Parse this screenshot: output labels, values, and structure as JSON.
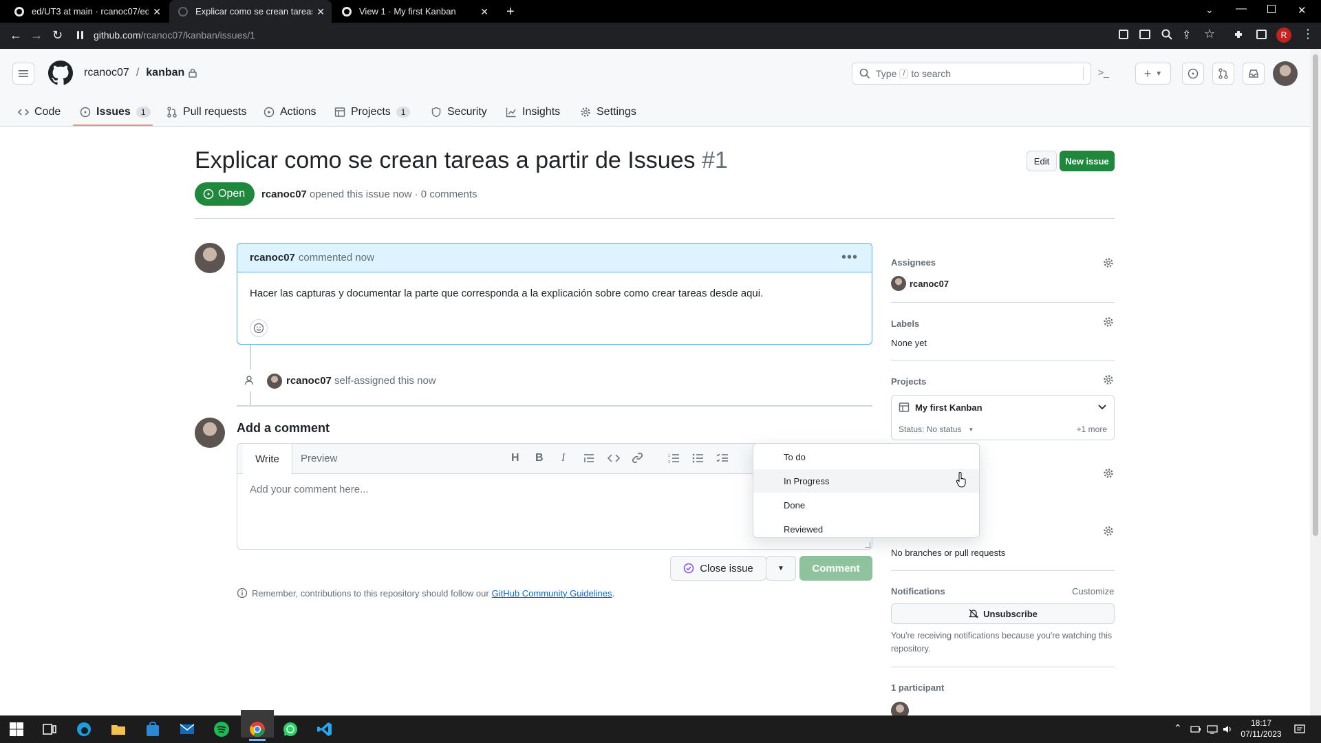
{
  "browser": {
    "tabs": [
      {
        "title": "ed/UT3 at main · rcanoc07/ed"
      },
      {
        "title": "Explicar como se crean tareas a ..."
      },
      {
        "title": "View 1 · My first Kanban"
      }
    ],
    "url_host": "github.com",
    "url_path": "/rcanoc07/kanban/issues/1",
    "profile_initial": "R"
  },
  "header": {
    "owner": "rcanoc07",
    "separator": "/",
    "repo": "kanban",
    "search_type": "Type",
    "search_key": "/",
    "search_rest": "to search"
  },
  "repo_nav": [
    {
      "label": "Code",
      "icon": "code-icon"
    },
    {
      "label": "Issues",
      "count": "1",
      "icon": "issue-icon"
    },
    {
      "label": "Pull requests",
      "icon": "pull-request-icon"
    },
    {
      "label": "Actions",
      "icon": "play-icon"
    },
    {
      "label": "Projects",
      "count": "1",
      "icon": "table-icon"
    },
    {
      "label": "Security",
      "icon": "shield-icon"
    },
    {
      "label": "Insights",
      "icon": "graph-icon"
    },
    {
      "label": "Settings",
      "icon": "gear-icon"
    }
  ],
  "issue": {
    "title": "Explicar como se crean tareas a partir de Issues",
    "number": "#1",
    "state": "Open",
    "author": "rcanoc07",
    "opened_text": "opened this issue now · 0 comments",
    "edit_label": "Edit",
    "new_issue_label": "New issue"
  },
  "comment": {
    "author": "rcanoc07",
    "time": "commented now",
    "body": "Hacer las capturas y documentar la parte que corresponda a la explicación sobre como crear tareas desde aqui."
  },
  "event": {
    "actor": "rcanoc07",
    "text": "self-assigned this now"
  },
  "composer": {
    "heading": "Add a comment",
    "tab_write": "Write",
    "tab_preview": "Preview",
    "placeholder": "Add your comment here...",
    "close_issue_label": "Close issue",
    "comment_label": "Comment",
    "note_prefix": "Remember, contributions to this repository should follow our",
    "note_link": "GitHub Community Guidelines",
    "note_suffix": "."
  },
  "sidebar": {
    "assignees_title": "Assignees",
    "assignee": "rcanoc07",
    "labels_title": "Labels",
    "labels_value": "None yet",
    "projects_title": "Projects",
    "project_name": "My first Kanban",
    "status_text": "Status: No status",
    "more_text": "+1 more",
    "development_value": "No branches or pull requests",
    "notifications_title": "Notifications",
    "customize": "Customize",
    "unsubscribe": "Unsubscribe",
    "notif_reason": "You're receiving notifications because you're watching this repository.",
    "participants": "1 participant"
  },
  "status_menu": {
    "options": [
      "To do",
      "In Progress",
      "Done",
      "Reviewed"
    ],
    "hovered": "In Progress"
  },
  "taskbar": {
    "time": "18:17",
    "date": "07/11/2023"
  },
  "colors": {
    "green": "#1f883d",
    "link": "#0969da",
    "accent_underline": "#fd8c73",
    "comment_header": "#ddf4ff"
  }
}
